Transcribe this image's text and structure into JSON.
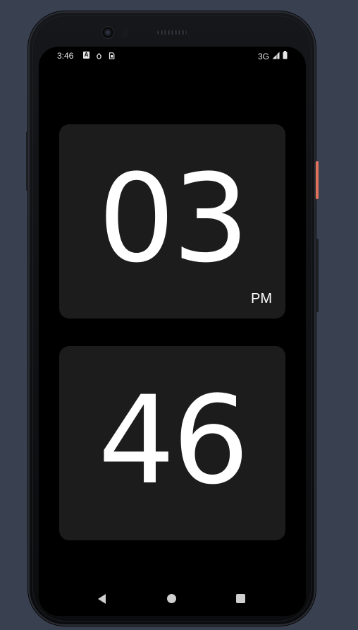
{
  "status_bar": {
    "time": "3:46",
    "notification_icons": [
      "a-notification-icon",
      "bug-icon",
      "sim-icon"
    ],
    "a_icon_letter": "A",
    "network_type": "3G",
    "right_icons": [
      "signal-icon",
      "battery-icon"
    ]
  },
  "clock": {
    "hours": "03",
    "minutes": "46",
    "meridiem": "PM"
  },
  "nav_bar": {
    "buttons": [
      "back",
      "home",
      "recents"
    ]
  },
  "colors": {
    "background": "#394150",
    "screen": "#000000",
    "card": "#1c1c1c",
    "digits": "#ffffff",
    "power_button": "#e0725c"
  }
}
